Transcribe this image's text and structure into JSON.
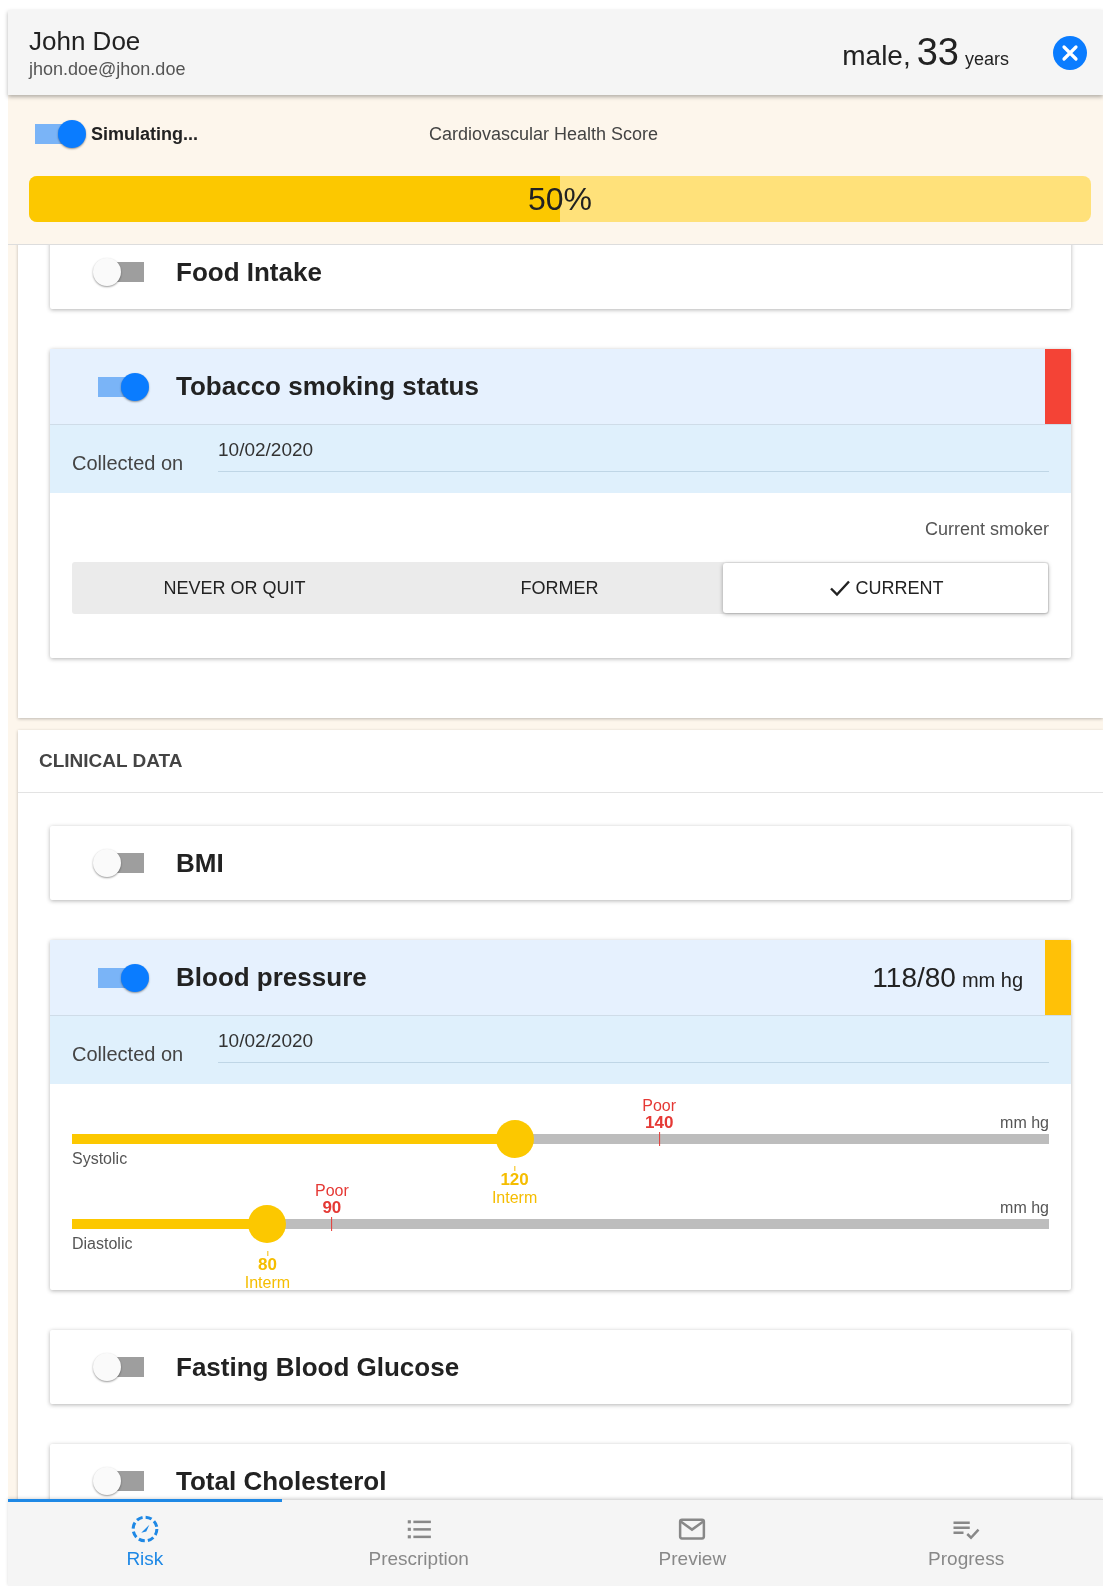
{
  "patient": {
    "name": "John Doe",
    "email": "jhon.doe@jhon.doe",
    "sex": "male,",
    "age": "33",
    "age_unit": "years"
  },
  "score": {
    "simulating": true,
    "simulating_label": "Simulating...",
    "title": "Cardiovascular Health Score",
    "level": 0.5,
    "reading": "50%"
  },
  "sections": [
    {
      "factors": [
        {
          "kind": "simple",
          "title": "Food Intake",
          "on": false
        },
        {
          "kind": "choice",
          "title": "Tobacco smoking status",
          "on": true,
          "color": "#f44336",
          "collected_label": "Collected on",
          "collected_date": "10/02/2020",
          "status": "Current smoker",
          "options": [
            {
              "label": "NEVER OR QUIT",
              "selected": false
            },
            {
              "label": "FORMER",
              "selected": false
            },
            {
              "label": "CURRENT",
              "selected": true
            }
          ]
        }
      ]
    },
    {
      "heading": "CLINICAL DATA",
      "factors": [
        {
          "kind": "simple",
          "title": "BMI",
          "on": false
        },
        {
          "kind": "sliders",
          "title": "Blood pressure",
          "on": true,
          "color": "#ffc107",
          "reading": "118/80",
          "reading_unit": "mm hg",
          "collected_label": "Collected on",
          "collected_date": "10/02/2020",
          "sliders": [
            {
              "label": "Systolic",
              "unit": "mm hg",
              "level": 0.453,
              "value": "120",
              "value_label": "Interm",
              "marker": {
                "label": "Poor",
                "value": "140",
                "level": 0.601
              }
            },
            {
              "label": "Diastolic",
              "unit": "mm hg",
              "level": 0.2,
              "value": "80",
              "value_label": "Interm",
              "marker": {
                "label": "Poor",
                "value": "90",
                "level": 0.266
              }
            }
          ]
        },
        {
          "kind": "simple",
          "title": "Fasting Blood Glucose",
          "on": false
        },
        {
          "kind": "simple",
          "title": "Total Cholesterol",
          "on": false
        }
      ]
    }
  ],
  "tabs": [
    {
      "label": "Risk",
      "selected": true
    },
    {
      "label": "Prescription",
      "selected": false
    },
    {
      "label": "Preview",
      "selected": false
    },
    {
      "label": "Progress",
      "selected": false
    }
  ]
}
